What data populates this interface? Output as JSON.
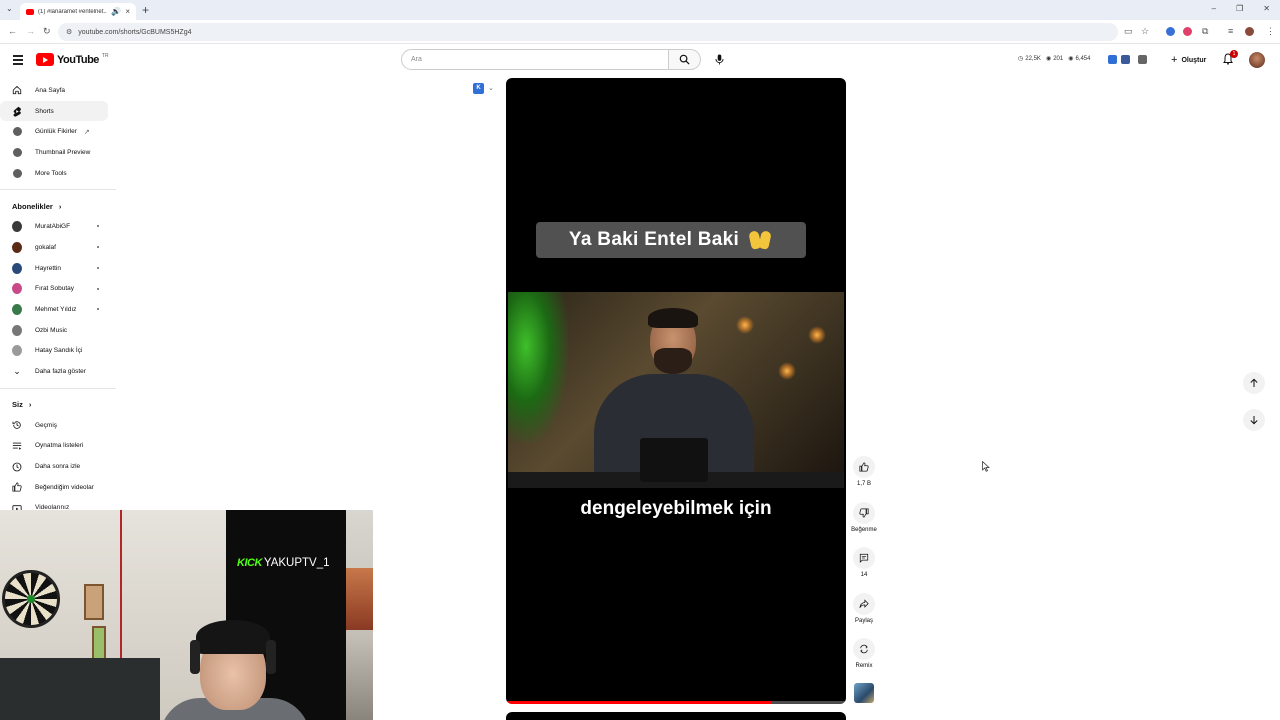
{
  "browser": {
    "tab_title": "(1) #lariaramet #entelnet...",
    "url": "youtube.com/shorts/GcBUMS5HZg4"
  },
  "header": {
    "logo_text": "YouTube",
    "country_code": "TR",
    "search_placeholder": "Ara",
    "stats": {
      "subs": "22,5K",
      "views": "201",
      "watch": "6,454"
    },
    "create_label": "Oluştur",
    "notification_count": "1"
  },
  "sidebar": {
    "main": [
      {
        "label": "Ana Sayfa",
        "icon": "home-icon"
      },
      {
        "label": "Shorts",
        "icon": "shorts-icon",
        "active": true
      },
      {
        "label": "Günlük Fikirler",
        "icon": "tool-icon",
        "external": true
      },
      {
        "label": "Thumbnail Preview",
        "icon": "tool-icon"
      },
      {
        "label": "More Tools",
        "icon": "tool-icon"
      }
    ],
    "subscriptions_heading": "Abonelikler",
    "subscriptions": [
      {
        "label": "MuratAbiGF",
        "color": "#3a3a3a",
        "new": true
      },
      {
        "label": "gokalaf",
        "color": "#5a2a14",
        "new": true
      },
      {
        "label": "Hayrettin",
        "color": "#2a4a7a",
        "new": true
      },
      {
        "label": "Fırat Sobutay",
        "color": "#c94a8a",
        "new": true
      },
      {
        "label": "Mehmet Yıldız",
        "color": "#3a7a4a",
        "new": true
      },
      {
        "label": "Ozbi Music",
        "color": "#777777",
        "new": false
      },
      {
        "label": "Hatay Sandık İçi",
        "color": "#9a9a9a",
        "new": false
      }
    ],
    "show_more": "Daha fazla göster",
    "you_heading": "Siz",
    "you": [
      {
        "label": "Geçmiş",
        "icon": "history-icon"
      },
      {
        "label": "Oynatma listeleri",
        "icon": "playlist-icon"
      },
      {
        "label": "Daha sonra izle",
        "icon": "clock-icon"
      },
      {
        "label": "Beğendiğim videolar",
        "icon": "thumbs-up-icon"
      },
      {
        "label": "Videolarınız",
        "icon": "video-icon"
      }
    ]
  },
  "short": {
    "caption_top": "Ya Baki Entel Baki",
    "caption_bottom": "dengeleyebilmek için",
    "progress": 0.78,
    "likes": "1,7 B",
    "dislike_label": "Beğenme",
    "comments": "14",
    "share_label": "Paylaş",
    "remix_label": "Remix"
  },
  "webcam": {
    "platform": "KICK",
    "channel": "YAKUPTV_1"
  },
  "colors": {
    "yt_red": "#ff0000",
    "kick_green": "#53fc18"
  }
}
